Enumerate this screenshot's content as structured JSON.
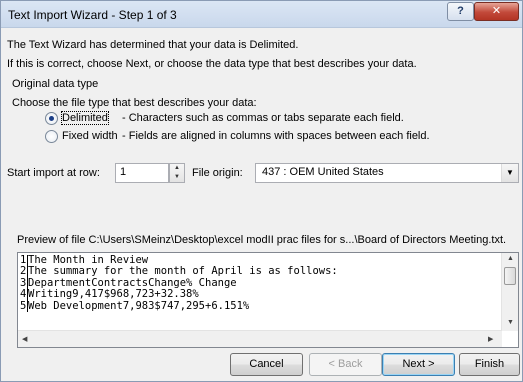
{
  "window": {
    "title": "Text Import Wizard - Step 1 of 3",
    "help_label": "?",
    "close_label": "✕"
  },
  "intro": {
    "line1": "The Text Wizard has determined that your data is Delimited.",
    "line2": "If this is correct, choose Next, or choose the data type that best describes your data."
  },
  "original_data_type": {
    "group_label": "Original data type",
    "prompt": "Choose the file type that best describes your data:",
    "options": [
      {
        "label": "Delimited",
        "description": "- Characters such as commas or tabs separate each field.",
        "checked": true
      },
      {
        "label": "Fixed width",
        "description": "- Fields are aligned in columns with spaces between each field.",
        "checked": false
      }
    ]
  },
  "start_import": {
    "label": "Start import at row:",
    "value": "1"
  },
  "file_origin": {
    "label": "File origin:",
    "value": "437 : OEM United States"
  },
  "preview": {
    "label": "Preview of file C:\\Users\\SMeinz\\Desktop\\excel modII prac files for s...\\Board of Directors Meeting.txt.",
    "lines": [
      {
        "n": "1",
        "text": "The Month in Review"
      },
      {
        "n": "2",
        "text": "The summary for the month of April is as follows:"
      },
      {
        "n": "3",
        "text": "DepartmentContractsChange% Change"
      },
      {
        "n": "4",
        "text": "Writing9,417$968,723+32.38%"
      },
      {
        "n": "5",
        "text": "Web Development7,983$747,295+6.151%"
      }
    ]
  },
  "buttons": {
    "cancel": "Cancel",
    "back": "< Back",
    "next": "Next >",
    "finish": "Finish"
  },
  "colors": {
    "dialog_bg": "#f0f0f0",
    "title_bar": "#c9d8ec",
    "close_button": "#c2493a",
    "default_button_border": "#3c7fb1"
  }
}
